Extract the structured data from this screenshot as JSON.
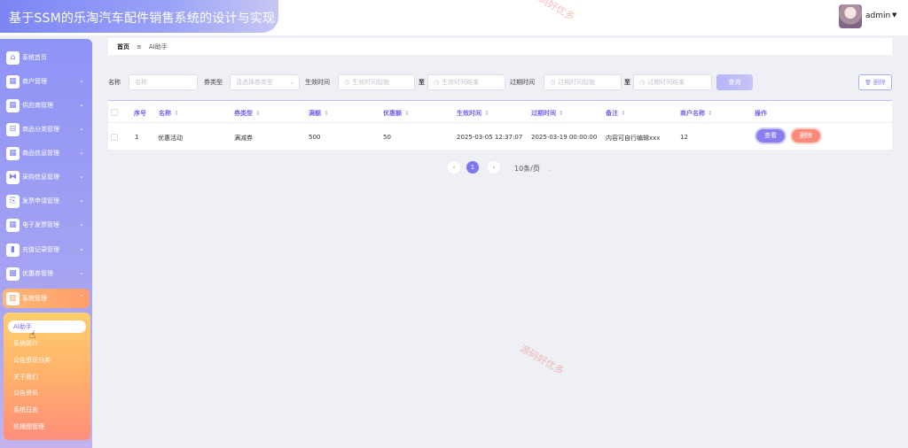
{
  "app": {
    "title": "基于SSM的乐淘汽车配件销售系统的设计与实现"
  },
  "user": {
    "name": "admin",
    "caret": "▼"
  },
  "sidebar": {
    "items": [
      {
        "label": "系统首页",
        "icon": "home-icon",
        "glyph": "⌂",
        "expandable": false
      },
      {
        "label": "商户管理",
        "icon": "grid-icon",
        "glyph": "▦",
        "expandable": true
      },
      {
        "label": "供应商管理",
        "icon": "grid-icon",
        "glyph": "▦",
        "expandable": true
      },
      {
        "label": "商品分类管理",
        "icon": "category-icon",
        "glyph": "⊟",
        "expandable": true
      },
      {
        "label": "商品信息管理",
        "icon": "grid-icon",
        "glyph": "▦",
        "expandable": true
      },
      {
        "label": "采购信息管理",
        "icon": "ticket-icon",
        "glyph": "⧓",
        "expandable": true
      },
      {
        "label": "发票申请管理",
        "icon": "clipboard-icon",
        "glyph": "⎘",
        "expandable": true
      },
      {
        "label": "电子发票管理",
        "icon": "grid-icon",
        "glyph": "▦",
        "expandable": true
      },
      {
        "label": "充值记录管理",
        "icon": "bar-chart-icon",
        "glyph": "▮",
        "expandable": true
      },
      {
        "label": "优惠券管理",
        "icon": "apps-icon",
        "glyph": "▩",
        "expandable": true
      },
      {
        "label": "系统管理",
        "icon": "book-icon",
        "glyph": "▥",
        "expandable": true,
        "active": true
      }
    ],
    "chevron_down": "⌄",
    "chevron_up": "⌃",
    "submenu": [
      {
        "label": "AI助手",
        "selected": true
      },
      {
        "label": "系统简介"
      },
      {
        "label": "公告资讯分类"
      },
      {
        "label": "关于我们"
      },
      {
        "label": "公告资讯"
      },
      {
        "label": "系统日志"
      },
      {
        "label": "轮播图管理"
      }
    ]
  },
  "breadcrumb": {
    "home": "首页",
    "separator": "≡",
    "current": "AI助手"
  },
  "search": {
    "name_label": "名称",
    "name_placeholder": "名称",
    "type_label": "券类型",
    "type_placeholder": "请选择券类型",
    "effective_label": "生效时间",
    "effective_start_placeholder": "生效时间起始",
    "effective_end_placeholder": "生效时间结束",
    "to": "至",
    "expire_label": "过期时间",
    "expire_start_placeholder": "过期时间起始",
    "expire_end_placeholder": "过期时间结束",
    "query_button": "查询",
    "bulk_delete_button": "删除",
    "clock_icon": "◷",
    "trash_icon": "🗑"
  },
  "table": {
    "headers": {
      "index": "序号",
      "name": "名称",
      "type": "券类型",
      "threshold": "满额",
      "discount": "优惠额",
      "effective": "生效时间",
      "expire": "过期时间",
      "remark": "备注",
      "merchant": "商户名称",
      "actions": "操作"
    },
    "sort_icon": "⇕",
    "rows": [
      {
        "index": "1",
        "name": "优惠活动",
        "type": "满减券",
        "threshold": "500",
        "discount": "50",
        "effective": "2025-03-05 12:37:07",
        "expire": "2025-03-19 00:00:00",
        "remark": "内容可自行编辑xxx",
        "merchant": "12"
      }
    ],
    "view_button": "查看",
    "delete_button": "删除"
  },
  "pagination": {
    "prev": "‹",
    "current_page": "1",
    "next": "›",
    "page_size": "10条/页",
    "caret": "⌄"
  },
  "watermark": {
    "text": "源码好优多"
  }
}
